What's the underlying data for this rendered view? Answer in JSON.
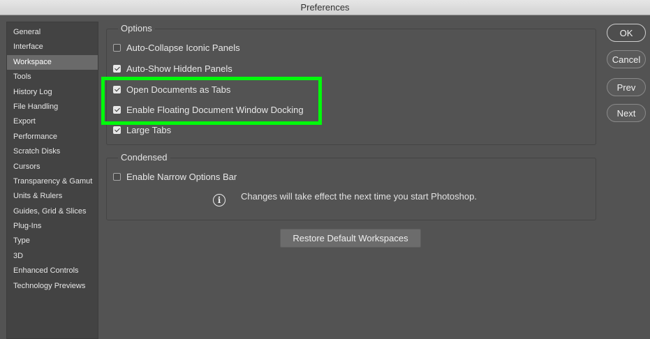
{
  "window": {
    "title": "Preferences"
  },
  "sidebar": {
    "items": [
      {
        "label": "General"
      },
      {
        "label": "Interface"
      },
      {
        "label": "Workspace"
      },
      {
        "label": "Tools"
      },
      {
        "label": "History Log"
      },
      {
        "label": "File Handling"
      },
      {
        "label": "Export"
      },
      {
        "label": "Performance"
      },
      {
        "label": "Scratch Disks"
      },
      {
        "label": "Cursors"
      },
      {
        "label": "Transparency & Gamut"
      },
      {
        "label": "Units & Rulers"
      },
      {
        "label": "Guides, Grid & Slices"
      },
      {
        "label": "Plug-Ins"
      },
      {
        "label": "Type"
      },
      {
        "label": "3D"
      },
      {
        "label": "Enhanced Controls"
      },
      {
        "label": "Technology Previews"
      }
    ],
    "selected": "Workspace"
  },
  "options": {
    "legend": "Options",
    "items": [
      {
        "label": "Auto-Collapse Iconic Panels",
        "checked": false
      },
      {
        "label": "Auto-Show Hidden Panels",
        "checked": true
      },
      {
        "label": "Open Documents as Tabs",
        "checked": true
      },
      {
        "label": "Enable Floating Document Window Docking",
        "checked": true
      },
      {
        "label": "Large Tabs",
        "checked": true
      }
    ]
  },
  "condensed": {
    "legend": "Condensed",
    "items": [
      {
        "label": "Enable Narrow Options Bar",
        "checked": false
      }
    ],
    "info_icon": "info-icon",
    "info_text": "Changes will take effect the next time you start Photoshop."
  },
  "restore_button": "Restore Default Workspaces",
  "buttons": {
    "ok": "OK",
    "cancel": "Cancel",
    "prev": "Prev",
    "next": "Next"
  },
  "colors": {
    "highlight": "#00f90b",
    "background": "#535353",
    "sidebar_bg": "#434343",
    "selected_bg": "#6a6a6a"
  }
}
